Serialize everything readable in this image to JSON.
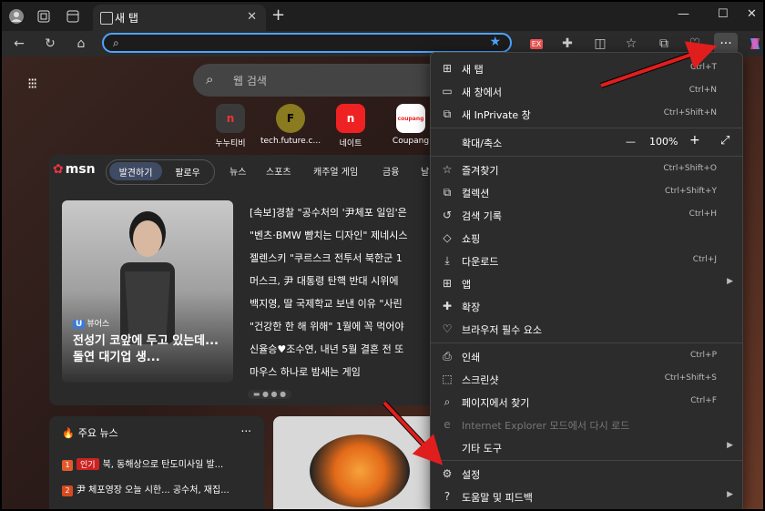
{
  "tab": {
    "title": "새 탭"
  },
  "search": {
    "placeholder": "웹 검색"
  },
  "tiles": [
    {
      "label": "누누티비",
      "mark": "n"
    },
    {
      "label": "tech.future.c...",
      "mark": "F"
    },
    {
      "label": "네이트",
      "mark": "n"
    },
    {
      "label": "Coupang",
      "mark": "coupang"
    }
  ],
  "msn": {
    "logo": "msn",
    "pill_active": "발견하기",
    "pill_other": "팔로우",
    "categories": [
      "뉴스",
      "스포츠",
      "캐주얼 게임",
      "금융",
      "날"
    ],
    "hero": {
      "source": "뷰어스",
      "source_badge": "U",
      "title": "전성기 코앞에 두고 있는데...돌연 대기업 생..."
    },
    "headlines": [
      "[속보]경찰 \"공수처의 '尹체포 일임'은",
      "\"벤츠·BMW 뺨치는 디자인\" 제네시스",
      "젤렌스키 \"쿠르스크 전투서 북한군 1",
      "머스크, 尹 대통령 탄핵 반대 시위에",
      "백지영, 딸 국제학교 보낸 이유 \"사린",
      "\"건강한 한 해 위해\" 1월에 꼭 먹어야",
      "신율승♥조수연, 내년 5월 결혼 전 또",
      "마우스 하나로 밤새는 게임"
    ],
    "top_news": {
      "title": "주요 뉴스",
      "more": "...",
      "items": [
        {
          "num": "1",
          "badge": "인기",
          "text": "북, 동해상으로 탄도미사일 발..."
        },
        {
          "num": "2",
          "badge": "",
          "text": "尹 체포영장 오늘 시한... 공수처, 재집..."
        }
      ]
    }
  },
  "menu": {
    "items": [
      {
        "icon": "new-tab-icon",
        "glyph": "⊞",
        "label": "새 탭",
        "shortcut": "Ctrl+T"
      },
      {
        "icon": "new-window-icon",
        "glyph": "▭",
        "label": "새 창에서",
        "shortcut": "Ctrl+N"
      },
      {
        "icon": "inprivate-icon",
        "glyph": "⧉",
        "label": "새 InPrivate 창",
        "shortcut": "Ctrl+Shift+N"
      },
      {
        "icon": "",
        "glyph": "",
        "label": "확대/축소",
        "shortcut": ""
      },
      {
        "icon": "favorites-icon",
        "glyph": "☆",
        "label": "즐겨찾기",
        "shortcut": "Ctrl+Shift+O"
      },
      {
        "icon": "collections-icon",
        "glyph": "⧉",
        "label": "컬렉션",
        "shortcut": "Ctrl+Shift+Y"
      },
      {
        "icon": "history-icon",
        "glyph": "↺",
        "label": "검색 기록",
        "shortcut": "Ctrl+H"
      },
      {
        "icon": "shopping-icon",
        "glyph": "◇",
        "label": "쇼핑",
        "shortcut": ""
      },
      {
        "icon": "download-icon",
        "glyph": "⤓",
        "label": "다운로드",
        "shortcut": "Ctrl+J"
      },
      {
        "icon": "apps-icon",
        "glyph": "⊞",
        "label": "앱",
        "shortcut": ""
      },
      {
        "icon": "extensions-icon",
        "glyph": "✚",
        "label": "확장",
        "shortcut": ""
      },
      {
        "icon": "browser-essentials-icon",
        "glyph": "♡",
        "label": "브라우저 필수 요소",
        "shortcut": ""
      },
      {
        "icon": "print-icon",
        "glyph": "⎙",
        "label": "인쇄",
        "shortcut": "Ctrl+P"
      },
      {
        "icon": "screenshot-icon",
        "glyph": "⬚",
        "label": "스크린샷",
        "shortcut": "Ctrl+Shift+S"
      },
      {
        "icon": "find-icon",
        "glyph": "⌕",
        "label": "페이지에서 찾기",
        "shortcut": "Ctrl+F"
      },
      {
        "icon": "ie-icon",
        "glyph": "e",
        "label": "Internet Explorer 모드에서 다시 로드",
        "shortcut": ""
      },
      {
        "icon": "",
        "glyph": "",
        "label": "기타 도구",
        "shortcut": ""
      },
      {
        "icon": "settings-icon",
        "glyph": "⚙",
        "label": "설정",
        "shortcut": ""
      },
      {
        "icon": "help-icon",
        "glyph": "?",
        "label": "도움말 및 피드백",
        "shortcut": ""
      }
    ],
    "zoom": {
      "minus": "—",
      "value": "100%",
      "plus": "+",
      "fullscreen": "⤢"
    }
  },
  "colors": {
    "accent": "#4ea3ff",
    "arrow": "#e01e1e",
    "hot": "#cc2222"
  }
}
